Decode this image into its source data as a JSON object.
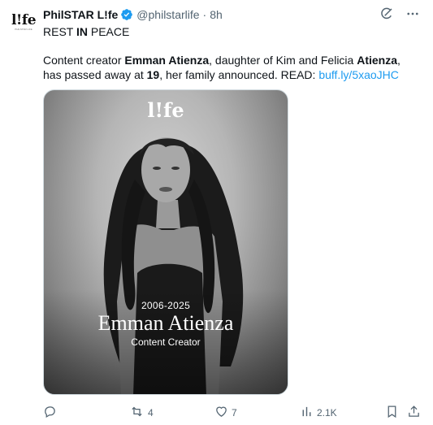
{
  "avatar": {
    "logo": "l!fe",
    "sub": "PHILSTAR LIFE"
  },
  "post": {
    "author_name": "PhilSTAR L!fe",
    "handle": "@philstarlife",
    "separator": "·",
    "time": "8h",
    "line1": {
      "a": "REST ",
      "b": "IN",
      "c": " PEACE"
    },
    "body": {
      "p1": "Content creator ",
      "p2": "Emman Atienza",
      "p3": ", daughter of Kim and Felicia ",
      "p4": "Atienza",
      "p5": ", has passed away at ",
      "p6": "19",
      "p7": ", her family announced. READ: ",
      "link": "buff.ly/5xaoJHC"
    }
  },
  "media": {
    "logo": "l!fe",
    "years": "2006-2025",
    "name": "Emman Atienza",
    "role": "Content Creator"
  },
  "actions": {
    "reply_count": "",
    "repost_count": "4",
    "like_count": "7",
    "views_count": "2.1K"
  },
  "icons": [
    "grok-icon",
    "more-icon",
    "reply-icon",
    "repost-icon",
    "like-icon",
    "views-icon",
    "bookmark-icon",
    "share-icon",
    "verified-badge-icon"
  ],
  "colors": {
    "link": "#1d9bf0",
    "muted": "#536471",
    "text": "#0f1419"
  }
}
